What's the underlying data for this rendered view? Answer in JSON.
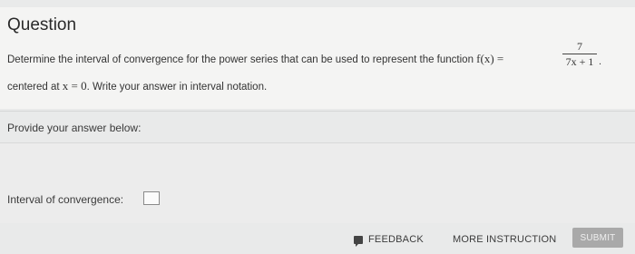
{
  "question": {
    "title": "Question",
    "line1_text": "Determine the interval of convergence for the power series that can be used to represent the function",
    "function_lhs": "f(x) =",
    "fraction_numerator": "7",
    "fraction_denominator": "7x + 1",
    "fraction_trailing": ".",
    "line2_prefix": "centered at",
    "line2_math": "x = 0",
    "line2_suffix": ". Write your answer in interval notation."
  },
  "answer": {
    "provide_label": "Provide your answer below:",
    "interval_label": "Interval of convergence:",
    "interval_value": ""
  },
  "footer": {
    "feedback_label": "FEEDBACK",
    "more_instruction_label": "MORE INSTRUCTION",
    "submit_label": "SUBMIT"
  },
  "icons": {
    "feedback": "feedback-icon"
  },
  "colors": {
    "submit_bg": "#a9a9a9",
    "page_bg": "#e9eaea"
  }
}
